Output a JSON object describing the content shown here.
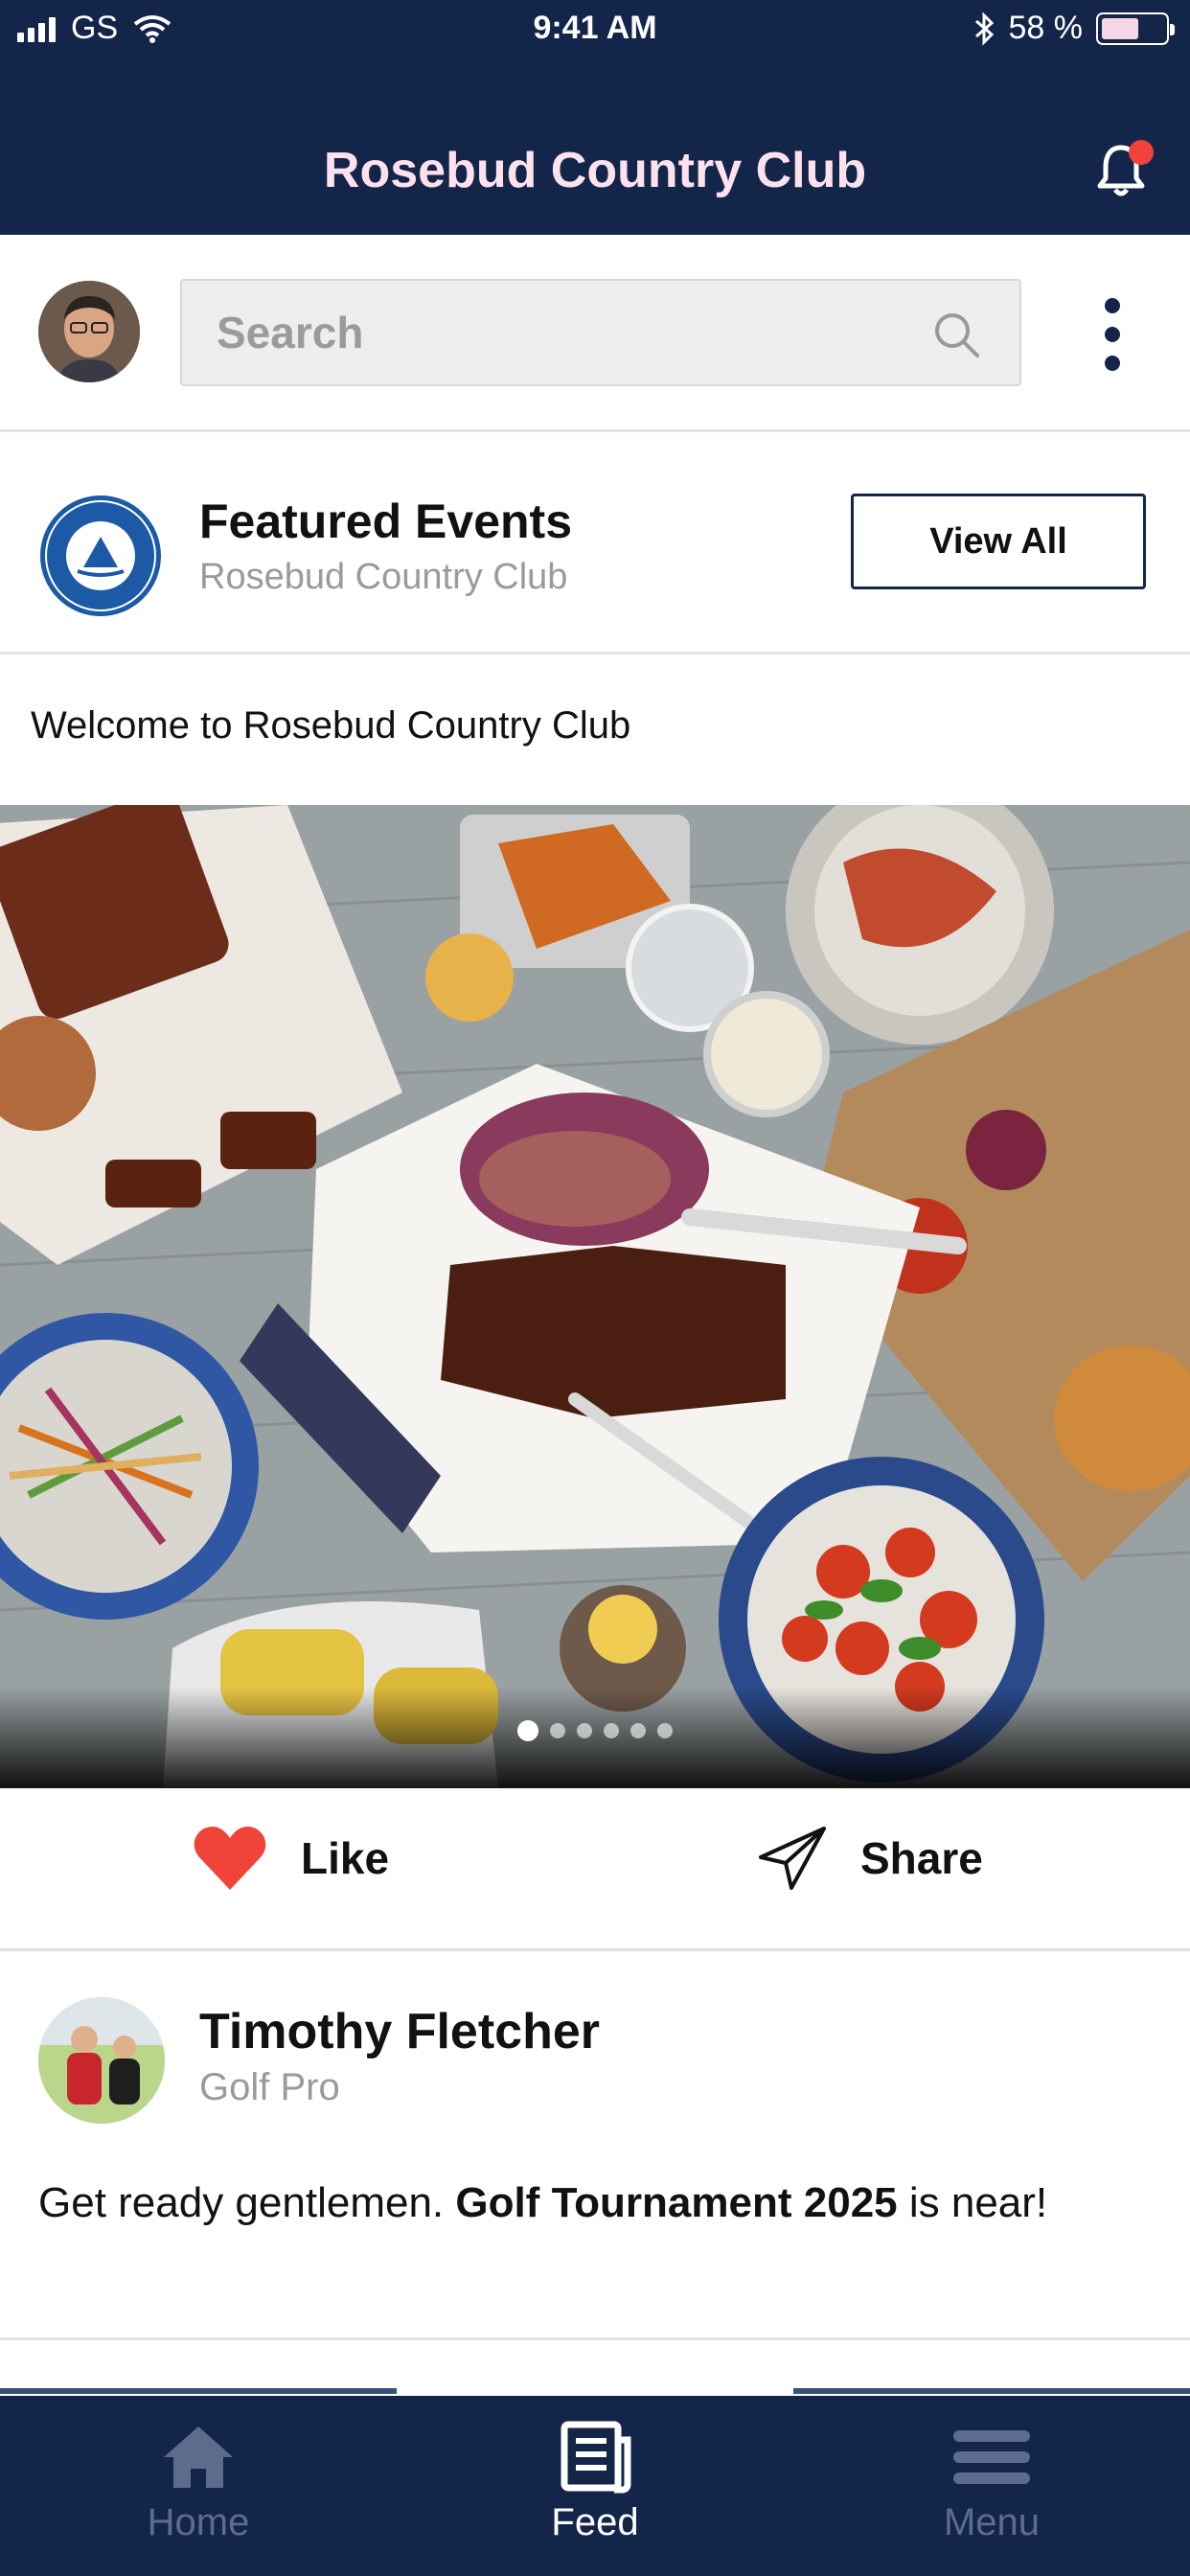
{
  "status_bar": {
    "carrier": "GS",
    "time": "9:41 AM",
    "battery": "58 %"
  },
  "header": {
    "title": "Rosebud Country Club"
  },
  "search": {
    "placeholder": "Search"
  },
  "featured": {
    "title": "Featured Events",
    "subtitle": "Rosebud Country Club",
    "view_all": "View All"
  },
  "welcome": "Welcome to  Rosebud Country Club",
  "carousel": {
    "total": 6,
    "active": 1
  },
  "actions": {
    "like": "Like",
    "share": "Share",
    "like_color": "#f0443a"
  },
  "post": {
    "author": "Timothy Fletcher",
    "role": "Golf Pro",
    "text_prefix": "Get ready gentlemen. ",
    "text_bold": "Golf Tournament 2025",
    "text_suffix": " is near!"
  },
  "tabs": [
    {
      "label": "Home",
      "icon": "home-icon",
      "active": false
    },
    {
      "label": "Feed",
      "icon": "feed-icon",
      "active": true
    },
    {
      "label": "Menu",
      "icon": "menu-icon",
      "active": false
    }
  ],
  "colors": {
    "header_bg": "#14254a",
    "title_color": "#fde2ee",
    "notification_dot": "#f0443a"
  }
}
